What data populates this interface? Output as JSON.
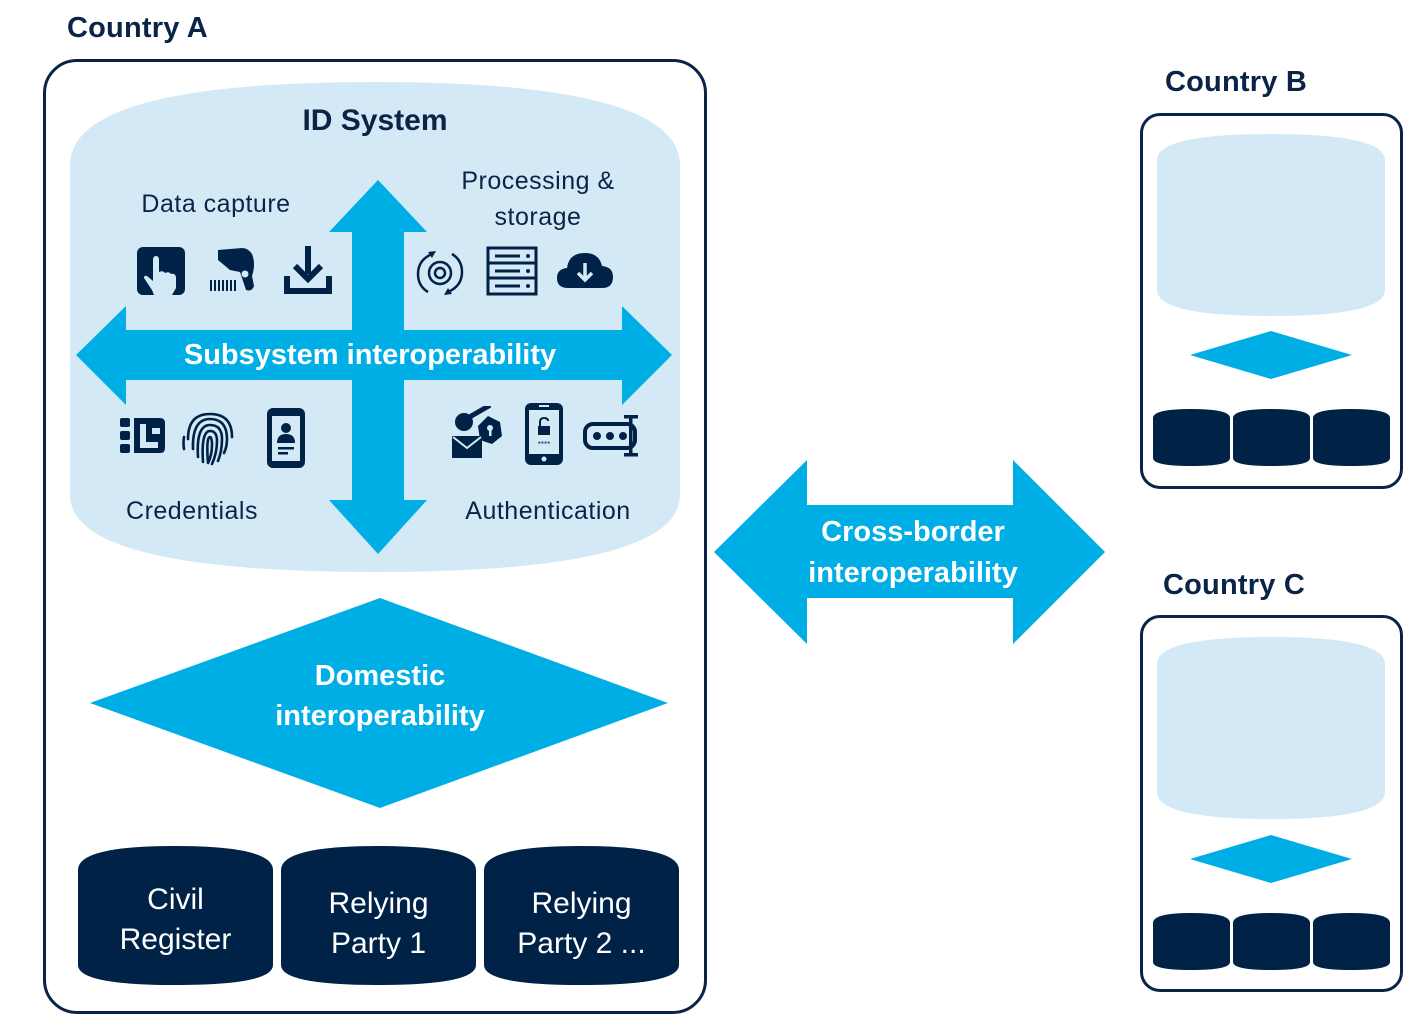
{
  "colors": {
    "navy": "#0a2448",
    "accent_blue": "#00aee6",
    "light_blue": "#d3eaf6",
    "background": "#ffffff"
  },
  "country_a": {
    "title": "Country A",
    "id_system": {
      "title": "ID System",
      "subsystem_arrow_label": "Subsystem interoperability",
      "quadrants": {
        "data_capture": {
          "label": "Data capture",
          "icons": [
            "touch-screen-icon",
            "barcode-scanner-icon",
            "download-tray-icon"
          ]
        },
        "processing_storage": {
          "label_line1": "Processing &",
          "label_line2": "storage",
          "icons": [
            "gear-sync-icon",
            "server-rack-icon",
            "cloud-download-icon"
          ]
        },
        "credentials": {
          "label": "Credentials",
          "icons": [
            "smart-card-chip-icon",
            "fingerprint-icon",
            "mobile-id-icon"
          ]
        },
        "authentication": {
          "label": "Authentication",
          "icons": [
            "envelope-key-lock-icon",
            "phone-unlock-pin-icon",
            "password-field-icon"
          ]
        }
      }
    },
    "domestic": {
      "line1": "Domestic",
      "line2": "interoperability"
    },
    "databases": [
      {
        "line1": "Civil",
        "line2": "Register"
      },
      {
        "line1": "Relying",
        "line2": "Party 1"
      },
      {
        "line1": "Relying",
        "line2": "Party 2 ..."
      }
    ]
  },
  "cross_border": {
    "line1": "Cross-border",
    "line2": "interoperability"
  },
  "country_b": {
    "title": "Country B"
  },
  "country_c": {
    "title": "Country C"
  }
}
